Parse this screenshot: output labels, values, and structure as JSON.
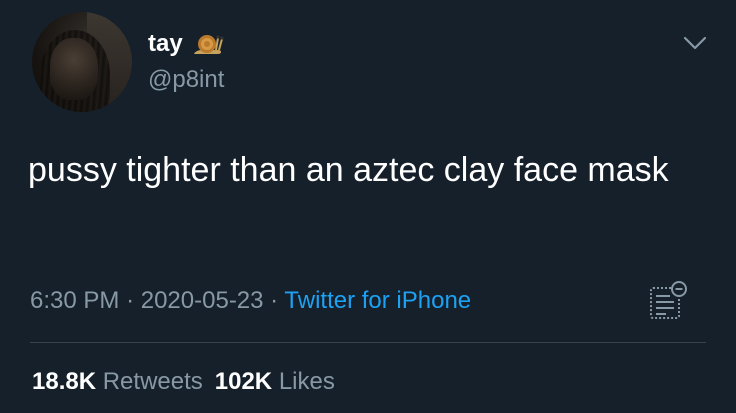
{
  "user": {
    "display_name": "tay",
    "handle": "@p8int",
    "badge_icon": "snail-icon"
  },
  "tweet": {
    "text": "pussy tighter than an aztec clay face mask",
    "time": "6:30 PM",
    "date": "2020-05-23",
    "separator": "·",
    "source": "Twitter for iPhone"
  },
  "stats": {
    "retweets_count": "18.8K",
    "retweets_label": "Retweets",
    "likes_count": "102K",
    "likes_label": "Likes"
  },
  "icons": {
    "menu": "chevron-down-icon",
    "analytics": "analytics-icon"
  },
  "colors": {
    "background": "#15202b",
    "secondary_text": "#8899a6",
    "link": "#1da1f2",
    "divider": "#38444d"
  }
}
